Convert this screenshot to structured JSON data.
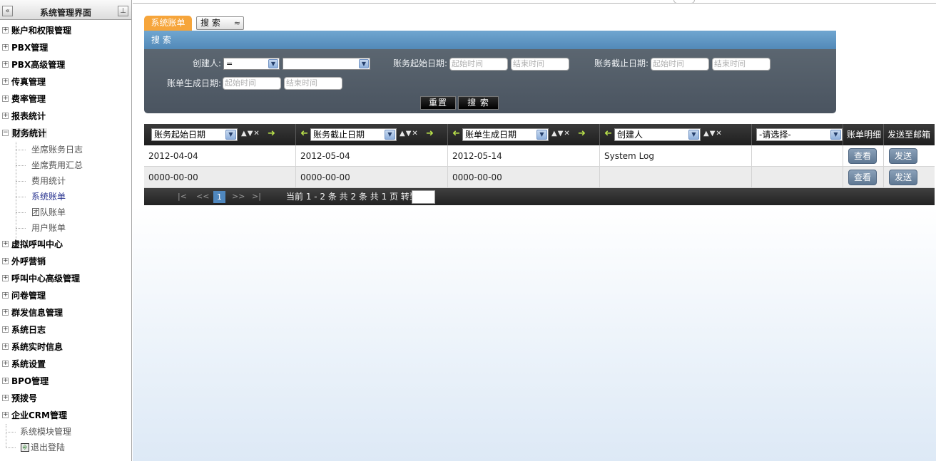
{
  "sidebar": {
    "title": "系统管理界面",
    "collapse_icon": "«",
    "pin_icon": "⊥",
    "items": [
      {
        "label": "账户和权限管理",
        "toggle": "+"
      },
      {
        "label": "PBX管理",
        "toggle": "+"
      },
      {
        "label": "PBX高级管理",
        "toggle": "+"
      },
      {
        "label": "传真管理",
        "toggle": "+"
      },
      {
        "label": "费率管理",
        "toggle": "+"
      },
      {
        "label": "报表统计",
        "toggle": "+"
      },
      {
        "label": "财务统计",
        "toggle": "−"
      },
      {
        "label": "虚拟呼叫中心",
        "toggle": "+"
      },
      {
        "label": "外呼营销",
        "toggle": "+"
      },
      {
        "label": "呼叫中心高级管理",
        "toggle": "+"
      },
      {
        "label": "问卷管理",
        "toggle": "+"
      },
      {
        "label": "群发信息管理",
        "toggle": "+"
      },
      {
        "label": "系统日志",
        "toggle": "+"
      },
      {
        "label": "系统实时信息",
        "toggle": "+"
      },
      {
        "label": "系统设置",
        "toggle": "+"
      },
      {
        "label": "BPO管理",
        "toggle": "+"
      },
      {
        "label": "预拨号",
        "toggle": "+"
      },
      {
        "label": "企业CRM管理",
        "toggle": "+"
      }
    ],
    "finance_children": [
      "坐席账务日志",
      "坐席费用汇总",
      "费用统计",
      "系统账单",
      "团队账单",
      "用户账单"
    ],
    "bottom_items": [
      "系统模块管理",
      "退出登陆"
    ],
    "logout_icon": "⎆"
  },
  "tabs": {
    "bills": "系统账单",
    "search": "搜 索",
    "search_chevron": "≈"
  },
  "search": {
    "header": "搜 索",
    "creator_label": "创建人:",
    "creator_operator": "=",
    "creator_value": "",
    "start_date_label": "账务起始日期:",
    "end_date_label": "账务截止日期:",
    "gen_date_label": "账单生成日期:",
    "from_placeholder": "起始时间",
    "to_placeholder": "结束时间",
    "reset": "重置",
    "submit": "搜 索"
  },
  "grid": {
    "columns": [
      {
        "label": "账务起始日期"
      },
      {
        "label": "账务截止日期"
      },
      {
        "label": "账单生成日期"
      },
      {
        "label": "创建人"
      },
      {
        "label": "-请选择-"
      },
      {
        "label": "账单明细"
      },
      {
        "label": "发送至邮箱"
      }
    ],
    "sort_icons": "▲▼✕",
    "rows": [
      {
        "start": "2012-04-04",
        "end": "2012-05-04",
        "generated": "2012-05-14",
        "creator": "System Log",
        "extra": "",
        "view": "查看",
        "send": "发送"
      },
      {
        "start": "0000-00-00",
        "end": "0000-00-00",
        "generated": "0000-00-00",
        "creator": "",
        "extra": "",
        "view": "查看",
        "send": "发送"
      }
    ]
  },
  "pager": {
    "first": "|<",
    "prev": "<<",
    "current": "1",
    "next": ">>",
    "last": ">|",
    "info": "当前 1 - 2 条 共 2 条 共 1 页 转到",
    "goto_value": ""
  }
}
